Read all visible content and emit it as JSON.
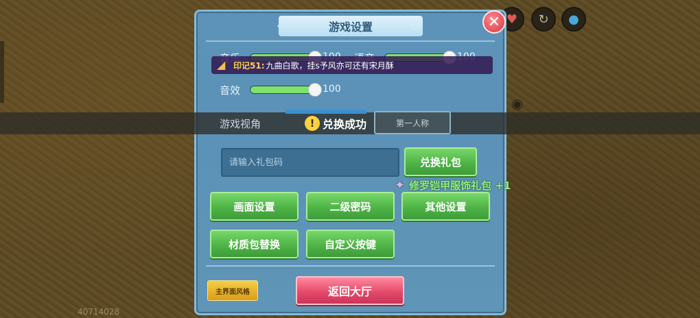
{
  "hud": {
    "heart_icon": "heart-icon",
    "refresh_icon": "refresh-icon",
    "water_icon": "water-drop-icon"
  },
  "panel": {
    "title": "游戏设置"
  },
  "audio": {
    "music_label": "音乐",
    "music_value": "100",
    "music_level": 1.0,
    "voice_label": "语音",
    "voice_value": "100",
    "voice_level": 1.0,
    "sfx_label": "音效",
    "sfx_value": "100",
    "sfx_level": 1.0
  },
  "marquee": {
    "sender": "印记51:",
    "message": "九曲白歌，挂s予风亦可还有宋月酥"
  },
  "view": {
    "label": "游戏视角",
    "first_person": "第一人称"
  },
  "toast": {
    "text": "兑换成功"
  },
  "gift": {
    "placeholder": "请输入礼包码",
    "redeem_label": "兑换礼包",
    "notification": "修罗铠甲服饰礼包 +1"
  },
  "buttons": {
    "graphics": "画面设置",
    "second_password": "二级密码",
    "other_settings": "其他设置",
    "texture_pack": "材质包替换",
    "custom_keys": "自定义按键",
    "main_ui_style": "主界面风格",
    "back_to_lobby": "返回大厅"
  },
  "footer": {
    "uid": "40714028"
  },
  "colors": {
    "panel_bg": "#5d93b8",
    "green_button": "#4fb447",
    "red_button": "#e54a6a",
    "gold_button": "#f4cd47",
    "slider_fill": "#7fe36b"
  }
}
